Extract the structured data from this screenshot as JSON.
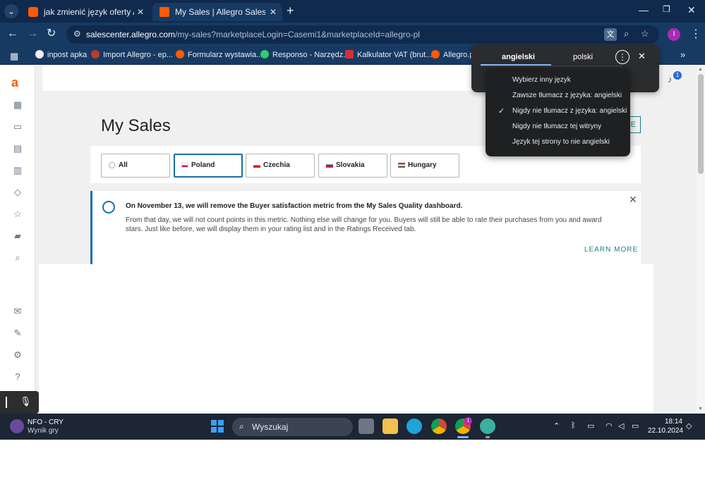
{
  "colors": {
    "chrome_dark": "#0f2a4d",
    "chrome": "#173a63",
    "accent_teal": "#1a7f8e",
    "selected_blue": "#1a6fa8",
    "allegro_orange": "#ff5a00"
  },
  "browser": {
    "tabs": [
      {
        "title": "jak zmienić język oferty ALLEGRO",
        "favicon": "allegro-icon",
        "active": false
      },
      {
        "title": "My Sales | Allegro Sales Center",
        "favicon": "allegro-square-icon",
        "active": true
      }
    ],
    "url_host": "salescenter.allegro.com",
    "url_path": "/my-sales?marketplaceLogin=Casemi1&marketplaceId=allegro-pl",
    "profile_initial": "I",
    "bookmarks": [
      {
        "label": "inpost apka",
        "icon": "inpost-icon"
      },
      {
        "label": "Import Allegro - ep...",
        "icon": "import-icon"
      },
      {
        "label": "Formularz wystawia...",
        "icon": "allegro-icon"
      },
      {
        "label": "Responso - Narzędz...",
        "icon": "responso-icon"
      },
      {
        "label": "Kalkulator VAT (brut...",
        "icon": "calculator-icon"
      },
      {
        "label": "Allegro.pl",
        "icon": "allegro-icon"
      }
    ]
  },
  "translate": {
    "source_lang": "angielski",
    "target_lang": "polski",
    "menu": [
      {
        "label": "Wybierz inny język",
        "checked": false
      },
      {
        "label": "Zawsze tłumacz z języka: angielski",
        "checked": false
      },
      {
        "label": "Nigdy nie tłumacz z języka: angielski",
        "checked": true
      },
      {
        "label": "Nigdy nie tłumacz tej witryny",
        "checked": false
      },
      {
        "label": "Język tej strony to nie angielski",
        "checked": false
      }
    ],
    "check_glyph": "✓"
  },
  "page": {
    "notification_count": "1",
    "title": "My Sales",
    "partial_button_label": "E",
    "marketplaces": [
      {
        "label": "All",
        "flag": "globe",
        "selected": false
      },
      {
        "label": "Poland",
        "flag": "poland",
        "selected": true
      },
      {
        "label": "Czechia",
        "flag": "czechia",
        "selected": false
      },
      {
        "label": "Slovakia",
        "flag": "slovakia",
        "selected": false
      },
      {
        "label": "Hungary",
        "flag": "hungary",
        "selected": false
      }
    ],
    "notice": {
      "title": "On November 13, we will remove the Buyer satisfaction metric from the My Sales Quality dashboard.",
      "body": "From that day, we will not count points in this metric. Nothing else will change for you. Buyers will still be able to rate their purchases from you and award stars. Just like before, we will display them in your rating list and in the Ratings Received tab.",
      "link": "LEARN MORE"
    }
  },
  "taskbar": {
    "game_title": "NFO - CRY",
    "game_subtitle": "Wynik gry",
    "search_placeholder": "Wyszukaj",
    "time": "18:14",
    "date": "22.10.2024",
    "chrome_badge": "1"
  }
}
